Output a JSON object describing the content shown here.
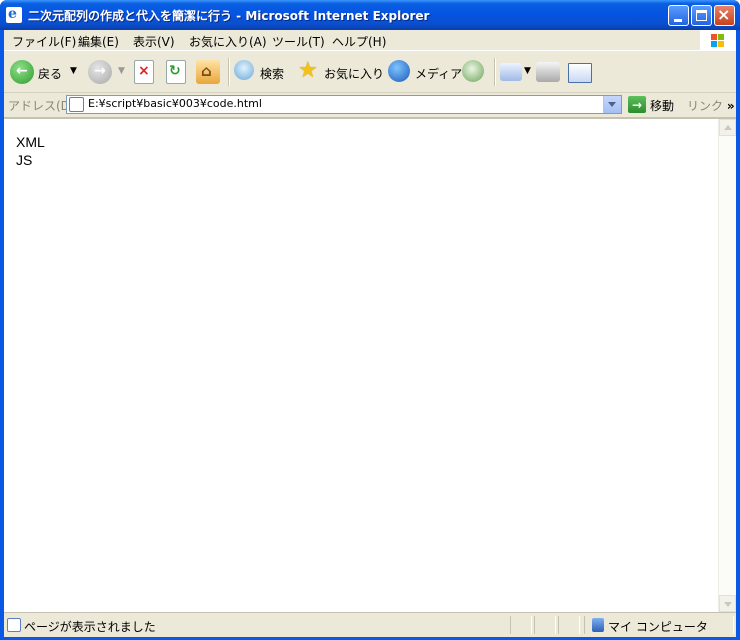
{
  "window": {
    "title": "二次元配列の作成と代入を簡潔に行う - Microsoft Internet Explorer",
    "minimize_icon": "minimize-icon",
    "maximize_icon": "maximize-icon",
    "close_icon": "close-icon"
  },
  "menubar": {
    "items": [
      {
        "label": "ファイル(F)"
      },
      {
        "label": "編集(E)"
      },
      {
        "label": "表示(V)"
      },
      {
        "label": "お気に入り(A)"
      },
      {
        "label": "ツール(T)"
      },
      {
        "label": "ヘルプ(H)"
      }
    ]
  },
  "toolbar": {
    "back_label": "戻る",
    "search_label": "検索",
    "favorites_label": "お気に入り",
    "media_label": "メディア",
    "icons": [
      "back-icon",
      "forward-icon",
      "stop-icon",
      "refresh-icon",
      "home-icon",
      "search-icon",
      "favorites-star-icon",
      "media-icon",
      "history-icon",
      "mail-icon",
      "print-icon",
      "edit-icon"
    ]
  },
  "addressbar": {
    "label": "アドレス(D)",
    "url": "E:¥script¥basic¥003¥code.html",
    "go_label": "移動",
    "links_label": "リンク"
  },
  "content": {
    "lines": [
      "XML",
      "JS"
    ]
  },
  "statusbar": {
    "text": "ページが表示されました",
    "zone": "マイ コンピュータ"
  },
  "colors": {
    "titlebar": "#0554e3",
    "chrome": "#ece9d8",
    "accent_green": "#2a8c2b"
  }
}
